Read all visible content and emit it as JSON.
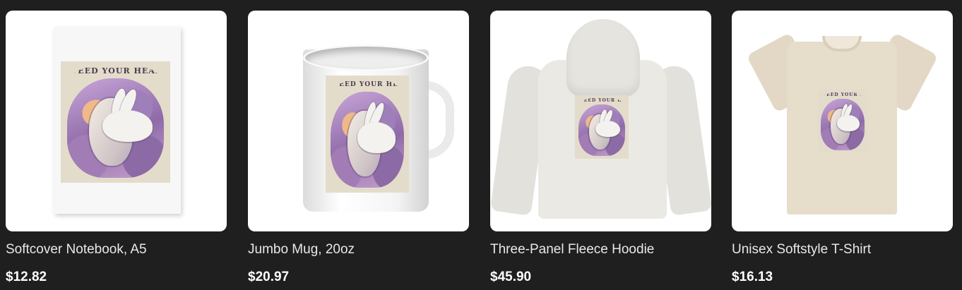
{
  "products": [
    {
      "name": "Softcover Notebook, A5",
      "price": "$12.82",
      "art_text": "FEED YOUR HEAD"
    },
    {
      "name": "Jumbo Mug, 20oz",
      "price": "$20.97",
      "art_text": "FEED YOUR HEAD"
    },
    {
      "name": "Three-Panel Fleece Hoodie",
      "price": "$45.90",
      "art_text": "FEED YOUR HEAD"
    },
    {
      "name": "Unisex Softstyle T-Shirt",
      "price": "$16.13",
      "art_text": "FEED YOUR HEAD"
    }
  ],
  "colors": {
    "background": "#1f1f1f",
    "card_image_bg": "#ffffff",
    "name_text": "#e8e8e8",
    "price_text": "#ffffff"
  }
}
